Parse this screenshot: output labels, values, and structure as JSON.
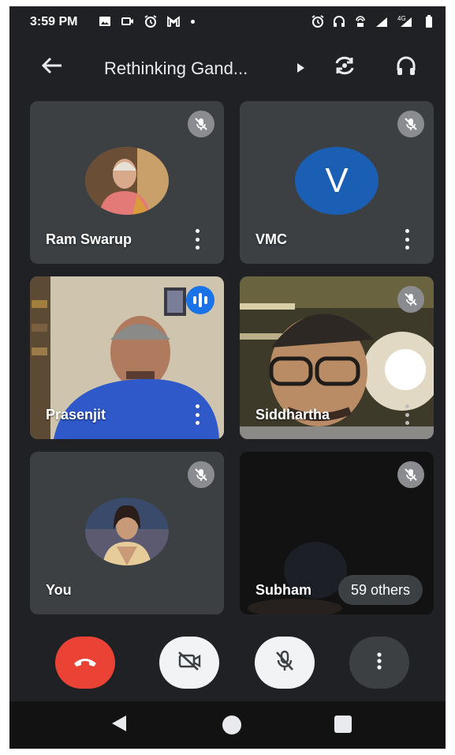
{
  "status_bar": {
    "time": "3:59 PM",
    "left_icons": [
      "image-icon",
      "video-cam-icon",
      "alarm-icon",
      "gmail-icon",
      "dot-icon"
    ],
    "right_icons": [
      "alarm-icon",
      "headphones-icon",
      "hotspot-icon",
      "signal-icon",
      "network-4g-icon",
      "battery-icon"
    ],
    "network_label": "4G"
  },
  "header": {
    "title": "Rethinking Gand...",
    "icons": [
      "arrow-back-icon",
      "caret-right-icon",
      "switch-camera-icon",
      "headphones-icon"
    ]
  },
  "participants": [
    {
      "name": "Ram Swarup",
      "muted": true,
      "avatar": "photo"
    },
    {
      "name": "VMC",
      "muted": true,
      "avatar": "letter",
      "avatar_letter": "V",
      "avatar_color": "#1a5fb4"
    },
    {
      "name": "Prasenjit",
      "muted": false,
      "speaking": true,
      "avatar": "video"
    },
    {
      "name": "Siddhartha",
      "muted": true,
      "avatar": "video"
    },
    {
      "name": "You",
      "muted": true,
      "avatar": "photo"
    },
    {
      "name": "Subham",
      "muted": true,
      "avatar": "video"
    }
  ],
  "others_label": "59 others",
  "controls": {
    "icons": [
      "end-call-icon",
      "camera-off-icon",
      "mic-off-icon",
      "more-vert-icon"
    ],
    "end_call_color": "#ea4335"
  },
  "nav_bar": {
    "icons": [
      "nav-back-icon",
      "nav-home-icon",
      "nav-recents-icon"
    ]
  }
}
